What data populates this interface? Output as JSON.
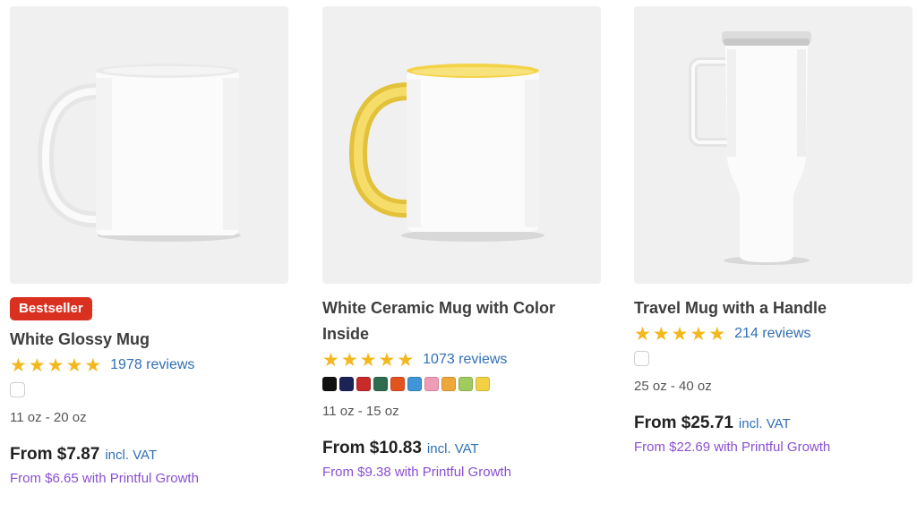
{
  "products": [
    {
      "badge": "Bestseller",
      "title": "White Glossy Mug",
      "rating": 5,
      "reviews": "1978 reviews",
      "size": "11 oz - 20 oz",
      "price": "From $7.87",
      "vat": "incl. VAT",
      "growth": "From $6.65 with Printful Growth"
    },
    {
      "title_line1": "White Ceramic Mug with Color",
      "title_line2": "Inside",
      "rating": 5,
      "reviews": "1073 reviews",
      "colors": [
        "#111111",
        "#1c2357",
        "#c92a2a",
        "#2e6b4f",
        "#e2531e",
        "#3f95d6",
        "#ef9cb8",
        "#eea83a",
        "#9fcc5c",
        "#f2d244"
      ],
      "size": "11 oz - 15 oz",
      "price": "From $10.83",
      "vat": "incl. VAT",
      "growth": "From $9.38 with Printful Growth"
    },
    {
      "title": "Travel Mug with a Handle",
      "rating": 5,
      "reviews": "214 reviews",
      "size": "25 oz - 40 oz",
      "price": "From $25.71",
      "vat": "incl. VAT",
      "growth": "From $22.69 with Printful Growth"
    }
  ],
  "theme": {
    "star_color": "#f4b71c",
    "link_color": "#2f6fb5",
    "growth_color": "#8a4fd1",
    "badge_color": "#d9301f"
  }
}
